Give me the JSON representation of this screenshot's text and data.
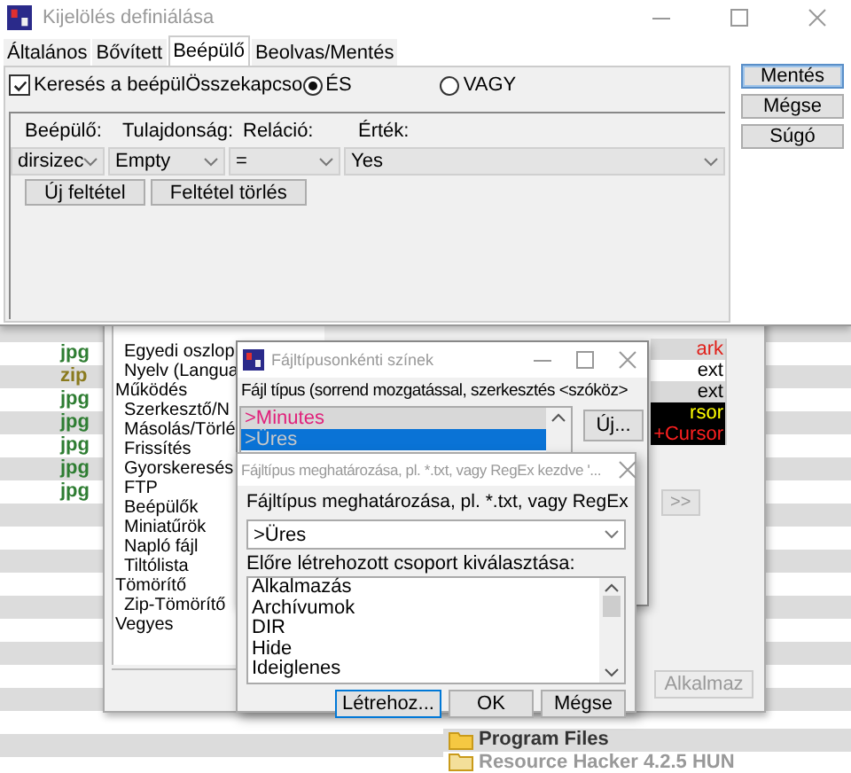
{
  "file_list": {
    "extensions": [
      {
        "text": "jpg",
        "color": "#2e7d32"
      },
      {
        "text": "zip",
        "color": "#8a7a1e"
      },
      {
        "text": "jpg",
        "color": "#2e7d32"
      },
      {
        "text": "jpg",
        "color": "#2e7d32"
      },
      {
        "text": "jpg",
        "color": "#2e7d32"
      },
      {
        "text": "jpg",
        "color": "#2e7d32"
      },
      {
        "text": "jpg",
        "color": "#2e7d32"
      }
    ],
    "folders": [
      {
        "name": "Program Files",
        "disabled": false
      },
      {
        "name": "Resource Hacker 4.2.5 HUN",
        "disabled": true
      }
    ]
  },
  "options_window": {
    "tree": {
      "items_of_hidden_parent": [
        "Egyedi oszlop",
        "Nyelv (Langua"
      ],
      "nodes": [
        {
          "label": "Működés",
          "children": [
            {
              "label": "Szerkesztő/N"
            },
            {
              "label": "Másolás/Törlé"
            },
            {
              "label": "Frissítés"
            },
            {
              "label": "Gyorskeresés"
            },
            {
              "label": "FTP"
            },
            {
              "label": "Beépülők"
            },
            {
              "label": "Miniatűrök"
            },
            {
              "label": "Napló fájl"
            },
            {
              "label": "Tiltólista"
            }
          ]
        },
        {
          "label": "Tömörítő",
          "children": [
            {
              "label": "Zip-Tömörítő"
            }
          ]
        },
        {
          "label": "Vegyes"
        }
      ]
    },
    "color_samples": [
      {
        "text": "ark",
        "color": "#e0201a",
        "inverse": false
      },
      {
        "text": "ext",
        "color": "#000000",
        "inverse": false
      },
      {
        "text": "ext",
        "color": "#000000",
        "inverse": false
      },
      {
        "text": "rsor",
        "color": "#ffff00",
        "inverse": true
      },
      {
        "text": "+Cursor",
        "color": "#ff2020",
        "inverse": true
      }
    ],
    "next_button": ">>",
    "apply_button": {
      "label": "Alkalmaz",
      "disabled": true
    }
  },
  "filetype_window": {
    "title": "Fájltípusonkénti színek",
    "label": "Fájl típus (sorrend mozgatással, szerkesztés <szóköz>",
    "items": [
      {
        "text": ">Minutes",
        "color": "#e0207a",
        "selected": false
      },
      {
        "text": ">Üres",
        "selected": true
      }
    ],
    "new_button": "Új..."
  },
  "define_dialog": {
    "title": "Fájltípus meghatározása, pl. *.txt, vagy RegEx kezdve '...",
    "prompt": "Fájltípus meghatározása, pl. *.txt, vagy RegEx",
    "value": ">Üres",
    "group_label": "Előre létrehozott csoport kiválasztása:",
    "groups": [
      "Alkalmazás",
      "Archívumok",
      "DIR",
      "Hide",
      "Ideiglenes"
    ],
    "buttons": [
      "Létrehoz...",
      "OK",
      "Mégse"
    ]
  },
  "main_window": {
    "title": "Kijelölés definiálása",
    "tabs": [
      {
        "label": "Általános",
        "selected": false
      },
      {
        "label": "Bővített",
        "selected": false
      },
      {
        "label": "Beépülő",
        "selected": true
      },
      {
        "label": "Beolvas/Mentés",
        "selected": false
      }
    ],
    "plugin_search": {
      "label": "Keresés a beépül",
      "checked": true
    },
    "combine_label": "Összekapcso",
    "radios": [
      {
        "label": "ÉS",
        "selected": true
      },
      {
        "label": "VAGY",
        "selected": false
      }
    ],
    "columns": [
      "Beépülő:",
      "Tulajdonság:",
      "Reláció:",
      "Érték:"
    ],
    "condition": [
      "dirsizec",
      "Empty",
      "=",
      "Yes"
    ],
    "condition_buttons": [
      "Új feltétel",
      "Feltétel törlés"
    ],
    "side_buttons": [
      {
        "label": "Mentés",
        "default": true
      },
      {
        "label": "Mégse",
        "default": false
      },
      {
        "label": "Súgó",
        "default": false
      }
    ]
  }
}
